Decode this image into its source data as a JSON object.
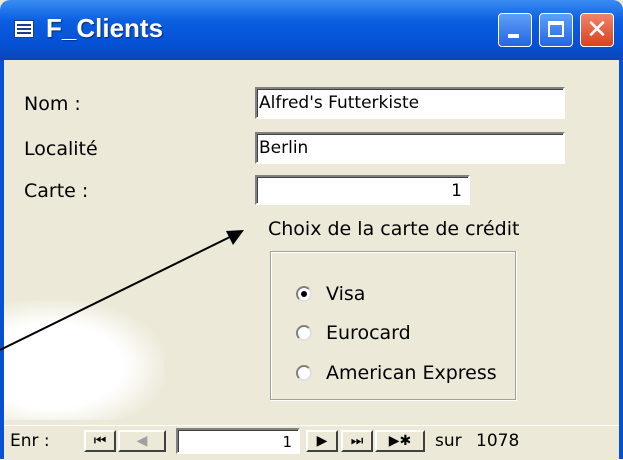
{
  "window": {
    "title": "F_Clients"
  },
  "fields": {
    "nom_label": "Nom :",
    "nom_value": "Alfred's Futterkiste",
    "localite_label": "Localité",
    "localite_value": "Berlin",
    "carte_label": "Carte  :",
    "carte_value": "1"
  },
  "group": {
    "caption": "Choix de la carte de crédit",
    "options": [
      {
        "label": "Visa",
        "selected": true
      },
      {
        "label": "Eurocard",
        "selected": false
      },
      {
        "label": "American Express",
        "selected": false
      }
    ]
  },
  "navigation": {
    "label": "Enr :",
    "current_record": "1",
    "total_prefix": "sur",
    "total": "1078",
    "icons": [
      "first-record-icon",
      "previous-record-icon",
      "next-record-icon",
      "last-record-icon",
      "new-record-icon"
    ]
  }
}
